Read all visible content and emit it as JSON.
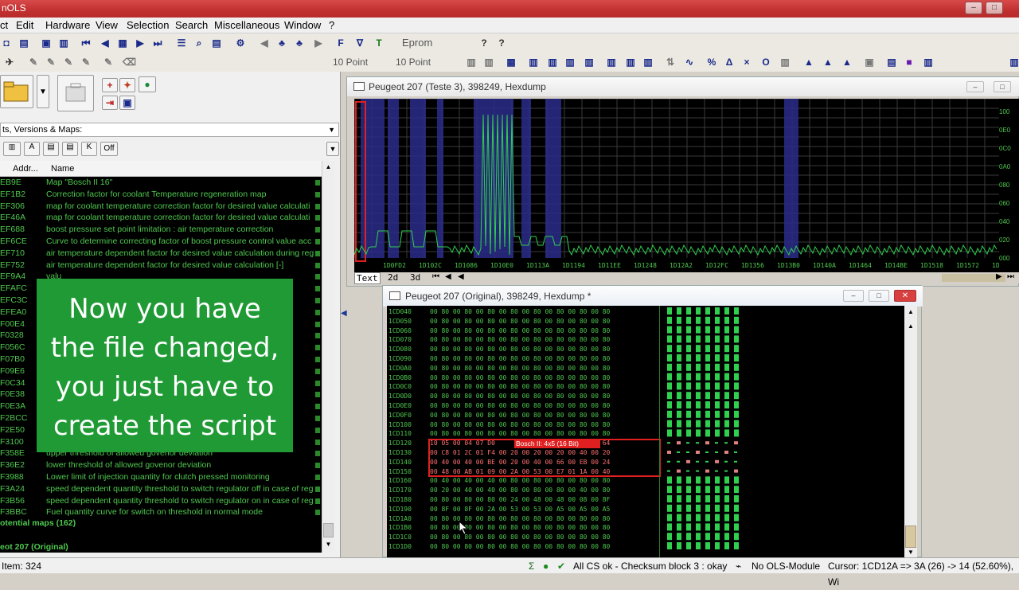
{
  "app": {
    "title": "nOLS"
  },
  "menu": [
    "ct",
    "Edit",
    "Hardware",
    "View",
    "Selection",
    "Search",
    "Miscellaneous",
    "Window",
    "?"
  ],
  "toolbar": {
    "eprom_label": "Eprom",
    "font1": "10 Point",
    "font2": "10 Point"
  },
  "left": {
    "combo_label": "ts, Versions & Maps:",
    "filter_off": "Off",
    "col_addr": "Addr...",
    "col_name": "Name",
    "rows": [
      {
        "addr": "EB9E",
        "name": "Map \"Bosch II 16\""
      },
      {
        "addr": "EF1B2",
        "name": "Correction factor for coolant Temperature regeneration map"
      },
      {
        "addr": "EF306",
        "name": "map for coolant temperature correction factor for desired value calculati"
      },
      {
        "addr": "EF46A",
        "name": "map for coolant temperature correction factor for desired value calculati"
      },
      {
        "addr": "EF688",
        "name": "boost pressure set point limitation : air temperature correction"
      },
      {
        "addr": "EF6CE",
        "name": "Curve to determine correcting factor of boost pressure control value acc"
      },
      {
        "addr": "EF710",
        "name": "air temperature dependent factor for desired value calculation during reg"
      },
      {
        "addr": "EF752",
        "name": "air temperature dependent factor for desired value calculation [-]"
      },
      {
        "addr": "EF9A4",
        "name": "valu"
      },
      {
        "addr": "EFAFC",
        "name": "valu"
      },
      {
        "addr": "EFC3C",
        "name": "valu"
      },
      {
        "addr": "EFEA0",
        "name": ""
      },
      {
        "addr": "F00E4",
        "name": "o Pre"
      },
      {
        "addr": "F0328",
        "name": "urbo I"
      },
      {
        "addr": "F056C",
        "name": ""
      },
      {
        "addr": "F07B0",
        "name": "ssure"
      },
      {
        "addr": "F09E6",
        "name": "(Turb"
      },
      {
        "addr": "F0C34",
        "name": "(Turb"
      },
      {
        "addr": "F0E38",
        "name": "essu"
      },
      {
        "addr": "F0E3A",
        "name": ""
      },
      {
        "addr": "F2BCC",
        "name": "ction c"
      },
      {
        "addr": "F2E50",
        "name": "ction q"
      },
      {
        "addr": "F3100",
        "name": ""
      },
      {
        "addr": "F358E",
        "name": "upper threshold of allowed govenor deviation"
      },
      {
        "addr": "F36E2",
        "name": "lower threshold of allowed govenor deviation"
      },
      {
        "addr": "F3988",
        "name": "Lower limit of injection quantity for clutch pressed monitoring"
      },
      {
        "addr": "F3A24",
        "name": "speed dependent quantity threshold to switch regulator off in case of reg"
      },
      {
        "addr": "F3B56",
        "name": "speed dependent quantity threshold to switch regulator on in case of reg"
      },
      {
        "addr": "F3BBC",
        "name": "Fuel quantity curve for switch on threshold in normal mode"
      }
    ],
    "group_potential": "otential maps (162)",
    "group_original": "eot 207 (Original)"
  },
  "overlay_text": [
    "Now you have",
    "the file changed,",
    "you just have to",
    "create the script"
  ],
  "chart_window": {
    "title": "Peugeot 207 (Teste 3), 398249, Hexdump",
    "x_ticks": [
      "1D0FD2",
      "1D102C",
      "1D1086",
      "1D10E0",
      "1D113A",
      "1D1194",
      "1D11EE",
      "1D1248",
      "1D12A2",
      "1D12FC",
      "1D1356",
      "1D13B0",
      "1D140A",
      "1D1464",
      "1D14BE",
      "1D1518",
      "1D1572",
      "1D1"
    ],
    "y_labels": [
      "100",
      "0E0",
      "0C0",
      "0A0",
      "080",
      "060",
      "040",
      "020",
      "000"
    ],
    "tabs": [
      "Text",
      "2d",
      "3d"
    ]
  },
  "hex_window": {
    "title": "Peugeot 207 (Original), 398249, Hexdump *",
    "map_label": "Bosch II: 4x5 (16 Bit)",
    "rows": [
      {
        "addr": "1CD040",
        "bytes": "00 80 00 80 00 80 00 80 00 80 00 80 00 80 00 80"
      },
      {
        "addr": "1CD050",
        "bytes": "00 80 00 80 00 80 00 80 00 80 00 80 00 80 00 80"
      },
      {
        "addr": "1CD060",
        "bytes": "00 80 00 80 00 80 00 80 00 80 00 80 00 80 00 80"
      },
      {
        "addr": "1CD070",
        "bytes": "00 80 00 80 00 80 00 80 00 80 00 80 00 80 00 80"
      },
      {
        "addr": "1CD080",
        "bytes": "00 80 00 80 00 80 00 80 00 80 00 80 00 80 00 80"
      },
      {
        "addr": "1CD090",
        "bytes": "00 80 00 80 00 80 00 80 00 80 00 80 00 80 00 80"
      },
      {
        "addr": "1CD0A0",
        "bytes": "00 80 00 80 00 80 00 80 00 80 00 80 00 80 00 80"
      },
      {
        "addr": "1CD0B0",
        "bytes": "00 80 00 80 00 80 00 80 00 80 00 80 00 80 00 80"
      },
      {
        "addr": "1CD0C0",
        "bytes": "00 80 00 80 00 80 00 80 00 80 00 80 00 80 00 80"
      },
      {
        "addr": "1CD0D0",
        "bytes": "00 80 00 80 00 80 00 80 00 80 00 80 00 80 00 80"
      },
      {
        "addr": "1CD0E0",
        "bytes": "00 80 00 80 00 80 00 80 00 80 00 80 00 80 00 80"
      },
      {
        "addr": "1CD0F0",
        "bytes": "00 80 00 80 00 80 00 80 00 80 00 80 00 80 00 80"
      },
      {
        "addr": "1CD100",
        "bytes": "00 80 00 80 00 80 00 80 00 80 00 80 00 80 00 80"
      },
      {
        "addr": "1CD110",
        "bytes": "00 80 00 80 00 80 00 80 00 80 00 80 00 80 00 80"
      },
      {
        "addr": "1CD120",
        "bytes": "10 05 00 04 07 D0                   4E 20 00 64"
      },
      {
        "addr": "1CD130",
        "bytes": "00 C8 01 2C 01 F4 00 20 00 20 00 20 00 40 00 20"
      },
      {
        "addr": "1CD140",
        "bytes": "00 40 00 40 00 BE 00 20 00 40 00 66 00 EB 00 24"
      },
      {
        "addr": "1CD150",
        "bytes": "00 48 00 AB 01 09 00 2A 00 53 00 E7 01 1A 00 40"
      },
      {
        "addr": "1CD160",
        "bytes": "00 40 00 40 00 40 00 80 00 80 00 80 00 80 00 80"
      },
      {
        "addr": "1CD170",
        "bytes": "00 20 00 40 00 40 00 80 00 80 00 80 00 40 00 80"
      },
      {
        "addr": "1CD180",
        "bytes": "00 80 00 80 00 80 00 24 00 48 00 48 00 08 00 8F"
      },
      {
        "addr": "1CD190",
        "bytes": "00 8F 00 8F 00 2A 00 53 00 53 00 A5 00 A5 00 A5"
      },
      {
        "addr": "1CD1A0",
        "bytes": "00 80 00 80 00 80 00 80 00 80 00 80 00 80 00 80"
      },
      {
        "addr": "1CD1B0",
        "bytes": "00 80 00 80 00 80 00 80 00 80 00 80 00 80 00 80"
      },
      {
        "addr": "1CD1C0",
        "bytes": "00 80 00 80 00 80 00 80 00 80 00 80 00 80 00 80"
      },
      {
        "addr": "1CD1D0",
        "bytes": "00 80 00 80 00 80 00 80 00 80 00 80 00 80 00 80"
      }
    ]
  },
  "status": {
    "left": "Item: 324",
    "cs": "All CS ok - Checksum block 3 : okay",
    "module": "No OLS-Module",
    "cursor": "Cursor: 1CD12A => 3A (26) -> 14 (52.60%), Wi"
  },
  "colors": {
    "title_red": "#c23030",
    "list_bg": "#000000",
    "list_text": "#4fc84f",
    "overlay_green": "#1f9a35",
    "chart_band": "#2c2c8a",
    "highlight_red": "#e02020"
  }
}
